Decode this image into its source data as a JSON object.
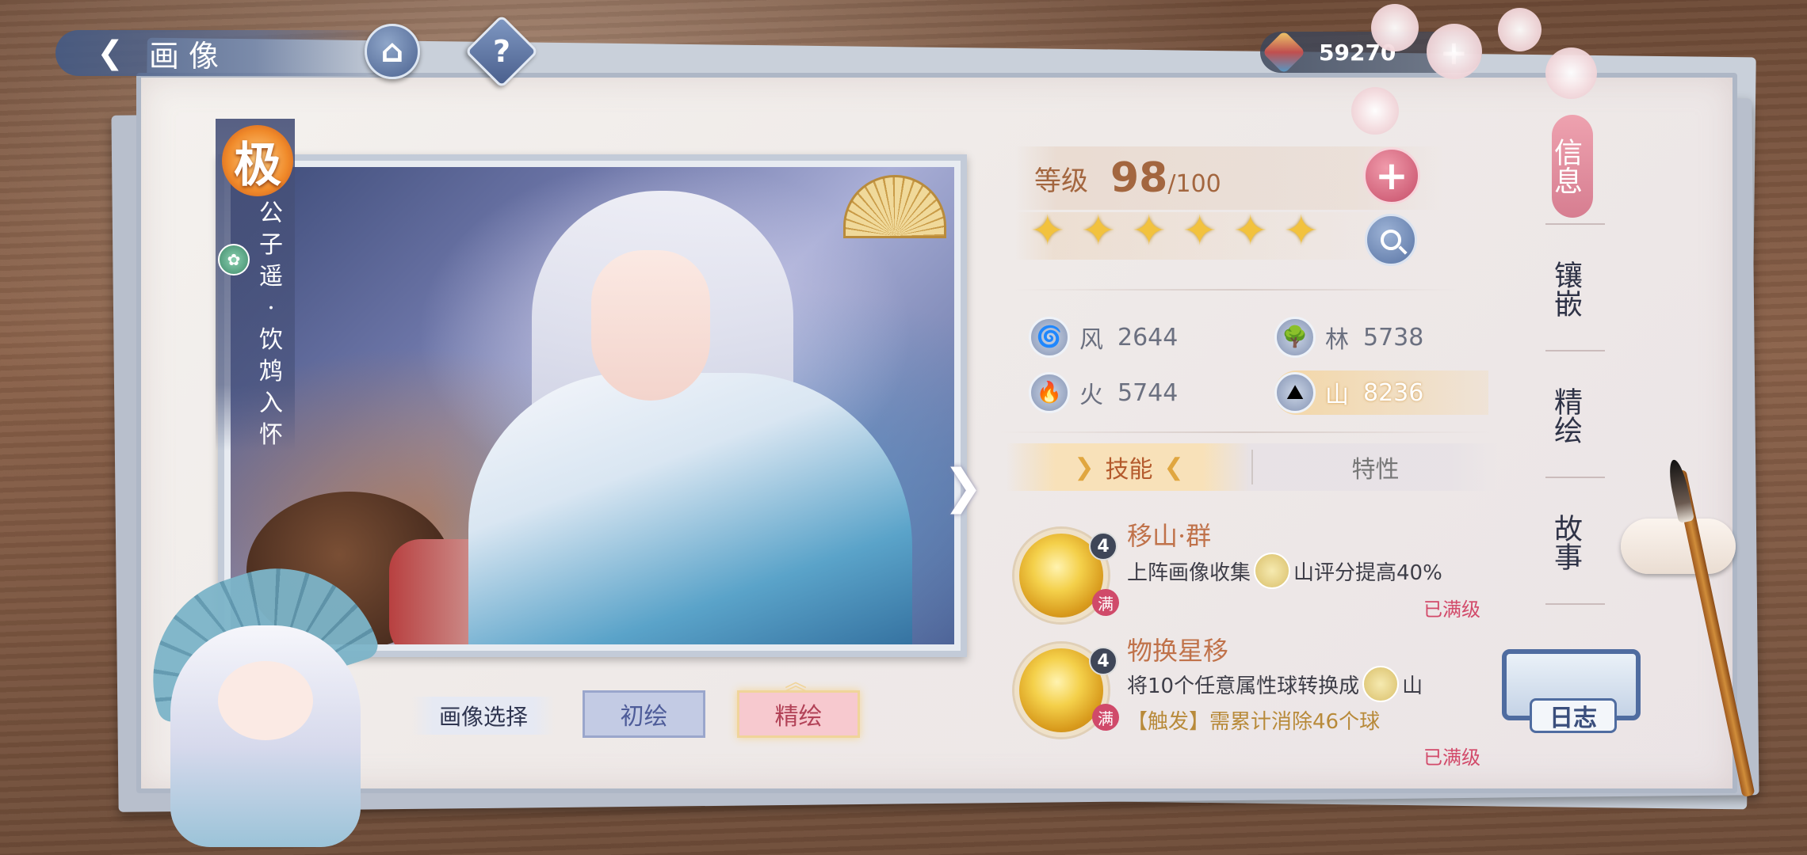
{
  "header": {
    "title": "画像",
    "help_label": "?"
  },
  "currency": {
    "value": "59270",
    "add_label": "+"
  },
  "portrait": {
    "rank": "极",
    "name_vertical": [
      "公",
      "子",
      "遥",
      "·",
      "饮",
      "鸩",
      "入",
      "怀"
    ]
  },
  "version_select": {
    "label": "画像选择",
    "options": [
      "初绘",
      "精绘"
    ],
    "selected": "精绘"
  },
  "level": {
    "label": "等级",
    "value": "98",
    "max": "/100",
    "stars": 6
  },
  "stats": [
    {
      "name": "风",
      "value": "2644",
      "icon": "wind-icon",
      "highlight": false
    },
    {
      "name": "林",
      "value": "5738",
      "icon": "tree-icon",
      "highlight": false
    },
    {
      "name": "火",
      "value": "5744",
      "icon": "fire-icon",
      "highlight": false
    },
    {
      "name": "山",
      "value": "8236",
      "icon": "mountain-icon",
      "highlight": true
    }
  ],
  "tabs": {
    "skill": "技能",
    "trait": "特性",
    "active": "技能"
  },
  "skills": [
    {
      "level": "4",
      "max_badge": "满",
      "name": "移山·群",
      "desc_before": "上阵画像收集",
      "desc_after": "山评分提高40%",
      "trigger": "",
      "status": "已满级"
    },
    {
      "level": "4",
      "max_badge": "满",
      "name": "物换星移",
      "desc_before": "将10个任意属性球转换成",
      "desc_after": "山",
      "trigger": "【触发】需累计消除46个球",
      "status": "已满级"
    }
  ],
  "side_nav": {
    "items": [
      {
        "label": "信息",
        "active": true
      },
      {
        "label": "镶嵌",
        "active": false
      },
      {
        "label": "精绘",
        "active": false
      },
      {
        "label": "故事",
        "active": false
      }
    ]
  },
  "journal": {
    "label": "日志"
  },
  "colors": {
    "accent_pink": "#d47287",
    "accent_gold": "#a3663f",
    "nav_blue": "#4f6ca0"
  }
}
